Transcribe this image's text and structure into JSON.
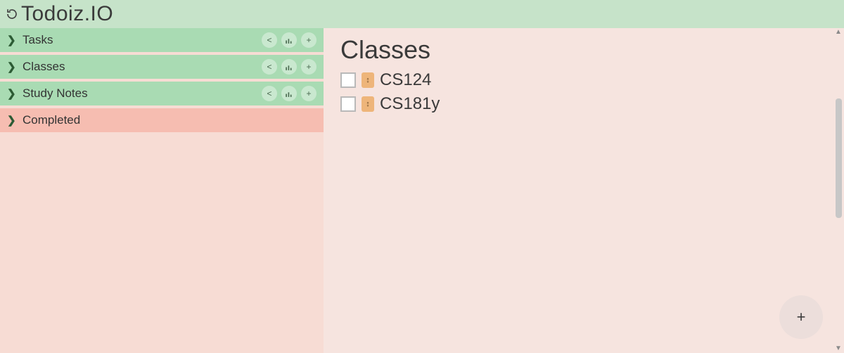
{
  "header": {
    "app_title": "Todoiz.IO"
  },
  "sidebar": {
    "categories": [
      {
        "label": "Tasks",
        "style": "green",
        "has_actions": true
      },
      {
        "label": "Classes",
        "style": "green",
        "has_actions": true
      },
      {
        "label": "Study Notes",
        "style": "green",
        "has_actions": true
      },
      {
        "label": "Completed",
        "style": "pink",
        "has_actions": false
      }
    ]
  },
  "main": {
    "title": "Classes",
    "items": [
      {
        "label": "CS124"
      },
      {
        "label": "CS181y"
      }
    ]
  },
  "fab": {
    "label": "+"
  }
}
